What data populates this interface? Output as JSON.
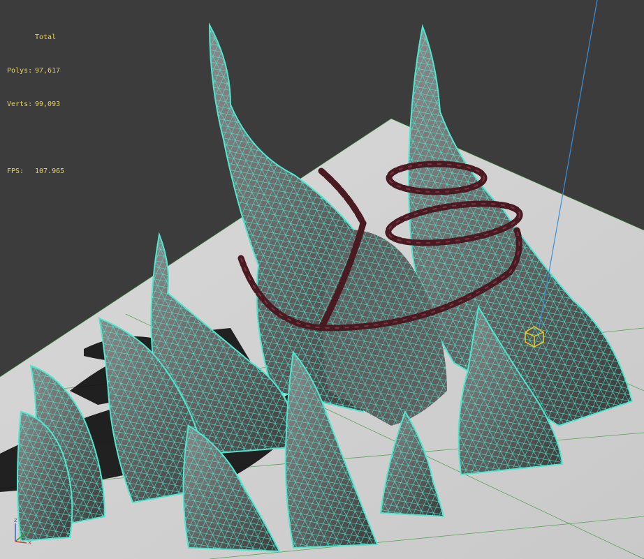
{
  "stats": {
    "header": "Total",
    "polys_label": "Polys:",
    "polys_value": "97,617",
    "verts_label": "Verts:",
    "verts_value": "99,093",
    "fps_label": "FPS:",
    "fps_value": "107.965"
  },
  "axis_gizmo": {
    "x": "x",
    "y": "y",
    "z": "z"
  },
  "colors": {
    "viewport_bg": "#3c3c3c",
    "ground": "#d4d4d4",
    "grid": "#2f8f2f",
    "wireframe": "#4ee6cf",
    "mesh": "#6f6f6f",
    "chain": "#4a1a22",
    "selection_gizmo": "#e8d020",
    "light_line": "#3a8fd6",
    "stats_text": "#e8d35a"
  },
  "icons": [
    "axis-gizmo-icon",
    "selection-box-icon"
  ]
}
